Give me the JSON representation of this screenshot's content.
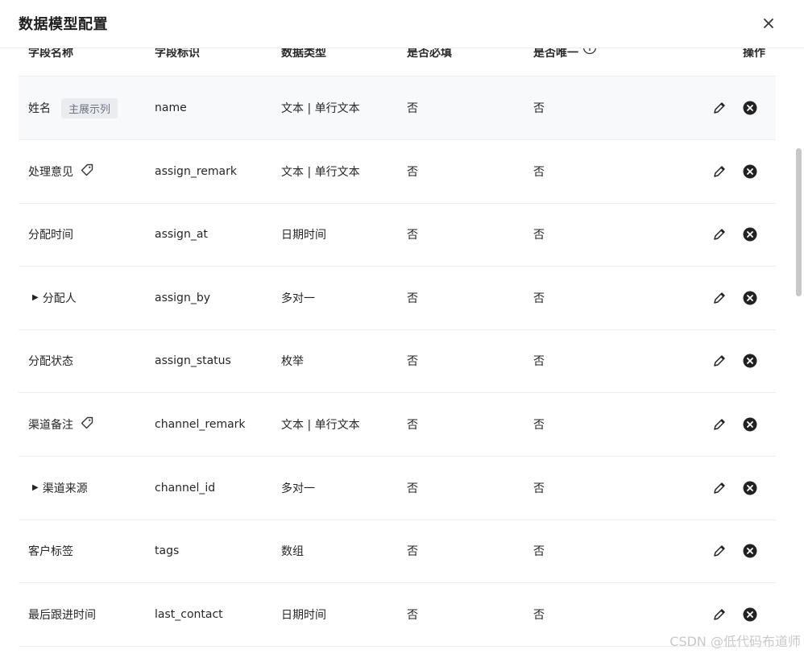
{
  "dialog": {
    "title": "数据模型配置",
    "close_icon": "close-icon"
  },
  "table": {
    "headers": {
      "name": "字段名称",
      "key": "字段标识",
      "type": "数据类型",
      "required": "是否必填",
      "unique": "是否唯一",
      "operations": "操作"
    },
    "rows": [
      {
        "name": "姓名",
        "badge": "主展示列",
        "key": "name",
        "type": "文本 | 单行文本",
        "required": "否",
        "unique": "否"
      },
      {
        "name": "处理意见",
        "key": "assign_remark",
        "type": "文本 | 单行文本",
        "required": "否",
        "unique": "否"
      },
      {
        "name": "分配时间",
        "key": "assign_at",
        "type": "日期时间",
        "required": "否",
        "unique": "否"
      },
      {
        "name": "分配人",
        "key": "assign_by",
        "type": "多对一",
        "required": "否",
        "unique": "否"
      },
      {
        "name": "分配状态",
        "key": "assign_status",
        "type": "枚举",
        "required": "否",
        "unique": "否"
      },
      {
        "name": "渠道备注",
        "key": "channel_remark",
        "type": "文本 | 单行文本",
        "required": "否",
        "unique": "否"
      },
      {
        "name": "渠道来源",
        "key": "channel_id",
        "type": "多对一",
        "required": "否",
        "unique": "否"
      },
      {
        "name": "客户标签",
        "key": "tags",
        "type": "数组",
        "required": "否",
        "unique": "否"
      },
      {
        "name": "最后跟进时间",
        "key": "last_contact",
        "type": "日期时间",
        "required": "否",
        "unique": "否"
      }
    ]
  },
  "watermark": "CSDN @低代码布道师",
  "colors": {
    "row_highlight": "#f8f9fb",
    "badge_bg": "#eaecf0",
    "border": "#ededed"
  }
}
